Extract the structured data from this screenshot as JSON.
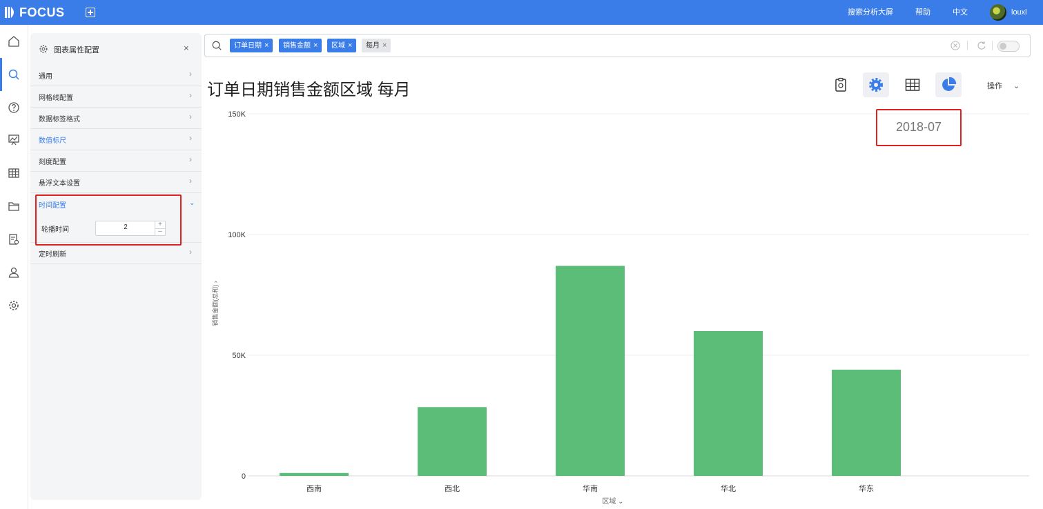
{
  "app": {
    "logo_text": "FOCUS"
  },
  "topnav": {
    "dashboard": "搜索分析大屏",
    "help": "帮助",
    "language": "中文",
    "user": "louxl"
  },
  "panel": {
    "title": "图表属性配置",
    "close": "×",
    "items": [
      {
        "label": "通用"
      },
      {
        "label": "网格线配置"
      },
      {
        "label": "数据标签格式"
      },
      {
        "label": "数值标尺"
      },
      {
        "label": "刻度配置"
      },
      {
        "label": "悬浮文本设置"
      },
      {
        "label": "时间配置"
      },
      {
        "label": "定时刷新"
      }
    ],
    "carousel_label": "轮播时间",
    "carousel_value": "2",
    "step_up": "+",
    "step_down": "–"
  },
  "search": {
    "chips": [
      {
        "label": "订单日期",
        "close": "×"
      },
      {
        "label": "销售金额",
        "close": "×"
      },
      {
        "label": "区域",
        "close": "×"
      },
      {
        "label": "每月",
        "close": "×"
      }
    ]
  },
  "title": "订单日期销售金额区域 每月",
  "toolbar": {
    "ops_label": "操作"
  },
  "chart_data": {
    "type": "bar",
    "categories": [
      "西南",
      "西北",
      "华南",
      "华北",
      "华东"
    ],
    "values": [
      1200,
      28500,
      87000,
      60000,
      44000
    ],
    "xlabel": "区域",
    "ylabel": "销售金额(总和)",
    "ylim": [
      0,
      150000
    ],
    "y_ticks": [
      "0",
      "50K",
      "100K",
      "150K"
    ],
    "grid": true,
    "period_label": "2018-07",
    "color": "#5bbd78"
  }
}
